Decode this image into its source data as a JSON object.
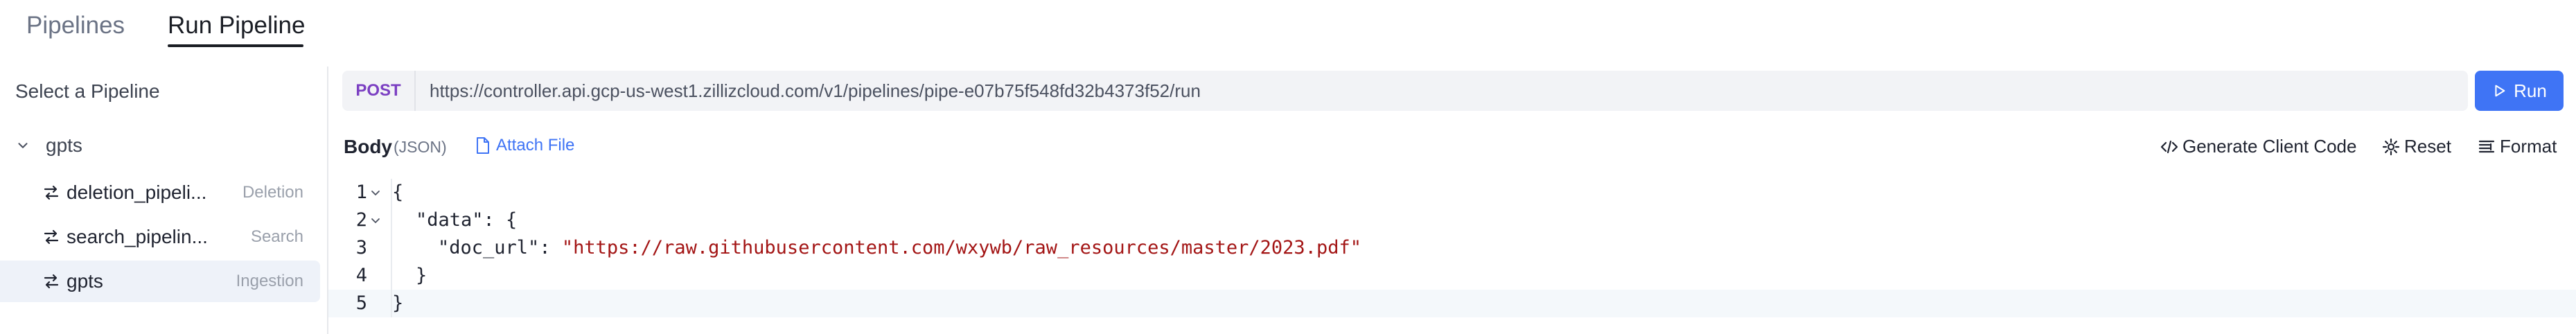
{
  "tabs": [
    {
      "label": "Pipelines",
      "active": false
    },
    {
      "label": "Run Pipeline",
      "active": true
    }
  ],
  "sidebar": {
    "title": "Select a Pipeline",
    "group": {
      "label": "gpts",
      "expanded": true
    },
    "items": [
      {
        "name": "deletion_pipeli...",
        "type": "Deletion",
        "selected": false
      },
      {
        "name": "search_pipelin...",
        "type": "Search",
        "selected": false
      },
      {
        "name": "gpts",
        "type": "Ingestion",
        "selected": true
      }
    ]
  },
  "request": {
    "method": "POST",
    "url": "https://controller.api.gcp-us-west1.zillizcloud.com/v1/pipelines/pipe-e07b75f548fd32b4373f52/run",
    "run_label": "Run"
  },
  "body": {
    "title": "Body",
    "format": "(JSON)",
    "attach_label": "Attach File",
    "actions": {
      "generate": "Generate Client Code",
      "reset": "Reset",
      "format": "Format"
    }
  },
  "editor": {
    "lines": [
      {
        "num": "1"
      },
      {
        "num": "2"
      },
      {
        "num": "3"
      },
      {
        "num": "4"
      },
      {
        "num": "5"
      }
    ],
    "l1": "{",
    "l2_key": "\"data\"",
    "l2_rest": ": {",
    "l3_key": "\"doc_url\"",
    "l3_sep": ": ",
    "l3_val": "\"https://raw.githubusercontent.com/wxywb/raw_resources/master/2023.pdf\"",
    "l4": "}",
    "l5": "}"
  },
  "colors": {
    "accent": "#3f74f5",
    "method": "#7b3fc2",
    "string": "#a31515"
  }
}
